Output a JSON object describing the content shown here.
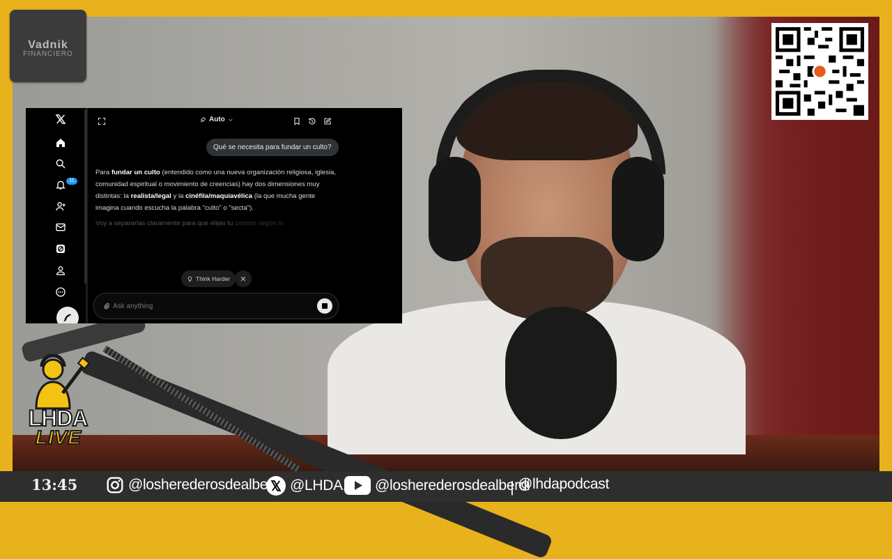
{
  "logo": {
    "line1": "Vadnik",
    "line2": "FINANCIERO"
  },
  "grok": {
    "mode_label": "Auto",
    "notification_count": "11",
    "user_message": "Qué se necesita para fundar un culto?",
    "answer": {
      "p1_a": "Para ",
      "p1_b": "fundar un culto",
      "p1_c": " (entendido como una nueva organización religiosa, iglesia, comunidad espiritual o movimiento de creencias) hay dos dimensiones muy distintas: la ",
      "p1_d": "realista/legal",
      "p1_e": " y la ",
      "p1_f": "cinéfila/maquiavélica",
      "p1_g": " (la que mucha gente imagina cuando escucha la palabra \"culto\" o \"secta\").",
      "p2_visible": "Voy a separarlas claramente para que elijas tu",
      "p2_faded": " camino según lo"
    },
    "think_harder_label": "Think Harder",
    "ask_placeholder": "Ask anything"
  },
  "show": {
    "line1": "LHDA",
    "line2": "LIVE"
  },
  "bottom_bar": {
    "time": "13:45",
    "instagram": "@losherederosdealberdi",
    "x": "@LHDA16",
    "youtube": "@losherederosdealberdi",
    "separator": "|",
    "podcast": "@lhdapodcast"
  }
}
